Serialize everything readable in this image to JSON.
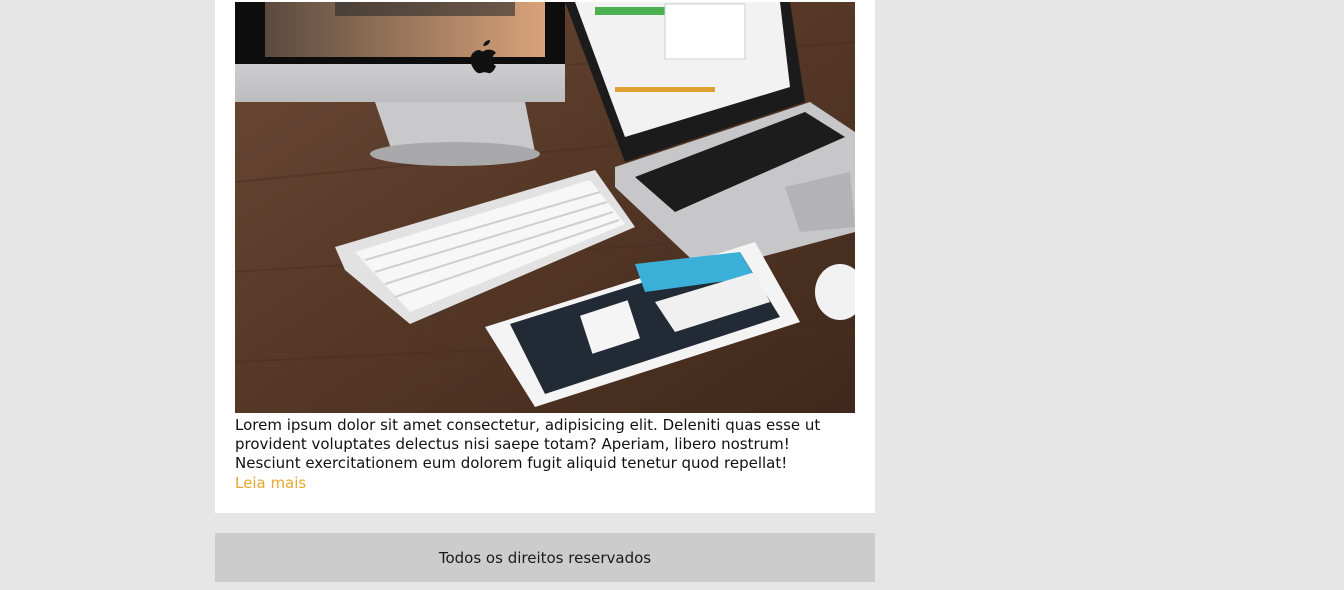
{
  "post": {
    "image_alt": "iMac, MacBook, Magic Keyboard e iPad sobre mesa de madeira",
    "excerpt": "Lorem ipsum dolor sit amet consectetur, adipisicing elit. Deleniti quas esse ut provident voluptates delectus nisi saepe totam? Aperiam, libero nostrum! Nesciunt exercitationem eum dolorem fugit aliquid tenetur quod repellat!",
    "read_more": "Leia mais"
  },
  "footer": {
    "text": "Todos os direitos reservados"
  },
  "colors": {
    "page_bg": "#e6e6e6",
    "card_bg": "#ffffff",
    "footer_bg": "#cccccc",
    "link": "#e8a82e"
  }
}
